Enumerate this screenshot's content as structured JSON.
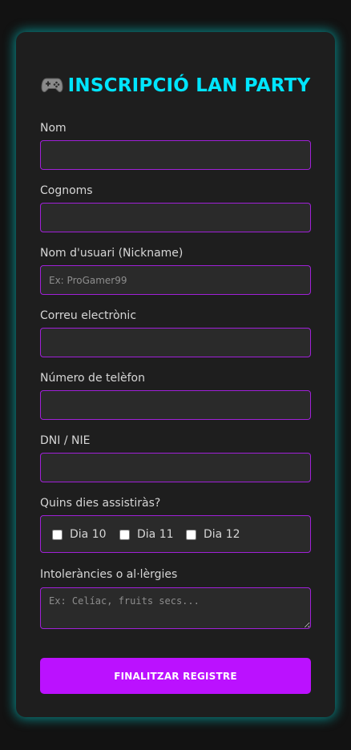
{
  "form": {
    "title": "INSCRIPCIÓ LAN PARTY",
    "title_icon": "gamepad-icon",
    "fields": {
      "nom": {
        "label": "Nom",
        "value": "",
        "placeholder": ""
      },
      "cognoms": {
        "label": "Cognoms",
        "value": "",
        "placeholder": ""
      },
      "nickname": {
        "label": "Nom d'usuari (Nickname)",
        "value": "",
        "placeholder": "Ex: ProGamer99"
      },
      "email": {
        "label": "Correu electrònic",
        "value": "",
        "placeholder": ""
      },
      "telefon": {
        "label": "Número de telèfon",
        "value": "",
        "placeholder": ""
      },
      "dni": {
        "label": "DNI / NIE",
        "value": "",
        "placeholder": ""
      }
    },
    "days": {
      "label": "Quins dies assistiràs?",
      "options": [
        {
          "label": "Dia 10",
          "checked": false
        },
        {
          "label": "Dia 11",
          "checked": false
        },
        {
          "label": "Dia 12",
          "checked": false
        }
      ]
    },
    "allergies": {
      "label": "Intoleràncies o al·lèrgies",
      "value": "",
      "placeholder": "Ex: Celíac, fruits secs..."
    },
    "submit_label": "FINALITZAR REGISTRE"
  },
  "colors": {
    "background": "#121212",
    "card": "#1e1e1e",
    "card_glow": "#00e6e6",
    "title": "#00e5ff",
    "field_border": "#a020d8",
    "field_bg": "#2a2a2a",
    "button": "#bb11ff"
  }
}
